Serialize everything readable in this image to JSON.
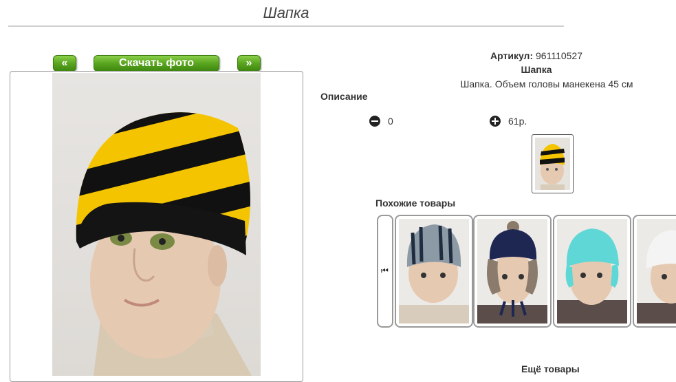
{
  "page": {
    "title": "Шапка"
  },
  "photo_controls": {
    "prev_label": "«",
    "download_label": "Скачать фото",
    "next_label": "»"
  },
  "product": {
    "article_label": "Артикул:",
    "article_value": "961110527",
    "name": "Шапка",
    "description": "Шапка. Объем головы манекена 45 см",
    "description_heading": "Описание",
    "quantity": "0",
    "price": "61р."
  },
  "similar": {
    "heading": "Похожие товары",
    "nav_icon": "skip-back-icon",
    "items": [
      "grey-striped-hat",
      "navy-pompom-earflap-hat",
      "turquoise-hat",
      "white-hat"
    ]
  },
  "more": {
    "heading": "Ещё товары"
  },
  "colors": {
    "button_green": "#5aa51f",
    "stripe_yellow": "#f5c400",
    "stripe_black": "#111111"
  }
}
